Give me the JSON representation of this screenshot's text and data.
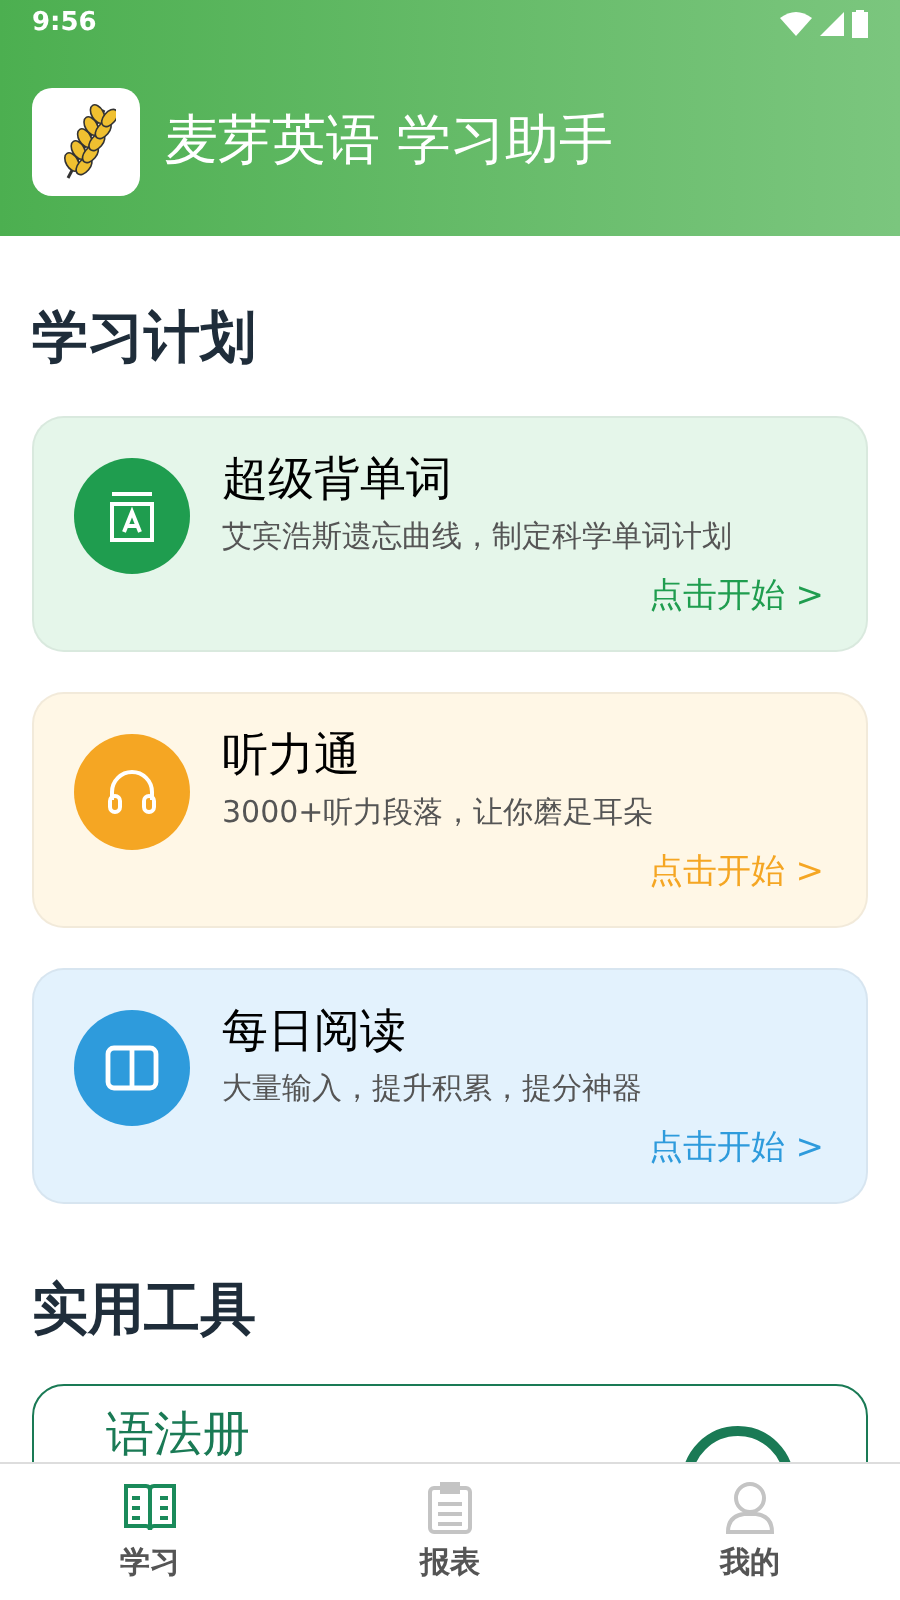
{
  "status_bar": {
    "time": "9:56"
  },
  "header": {
    "title": "麦芽英语 学习助手"
  },
  "plan_section": {
    "title": "学习计划"
  },
  "plans": [
    {
      "kind": "words",
      "title": "超级背单词",
      "subtitle": "艾宾浩斯遗忘曲线，制定科学单词计划",
      "action": "点击开始 >",
      "color": "#1f9d4f"
    },
    {
      "kind": "listening",
      "title": "听力通",
      "subtitle": "3000+听力段落，让你磨足耳朵",
      "action": "点击开始 >",
      "color": "#f5a623"
    },
    {
      "kind": "reading",
      "title": "每日阅读",
      "subtitle": "大量输入，提升积累，提分神器",
      "action": "点击开始 >",
      "color": "#2e9bdc"
    }
  ],
  "tools_section": {
    "title": "实用工具"
  },
  "tools": [
    {
      "title": "语法册"
    }
  ],
  "tab_bar": [
    {
      "kind": "study",
      "label": "学习",
      "selected": true
    },
    {
      "kind": "report",
      "label": "报表",
      "selected": false
    },
    {
      "kind": "me",
      "label": "我的",
      "selected": false
    }
  ]
}
